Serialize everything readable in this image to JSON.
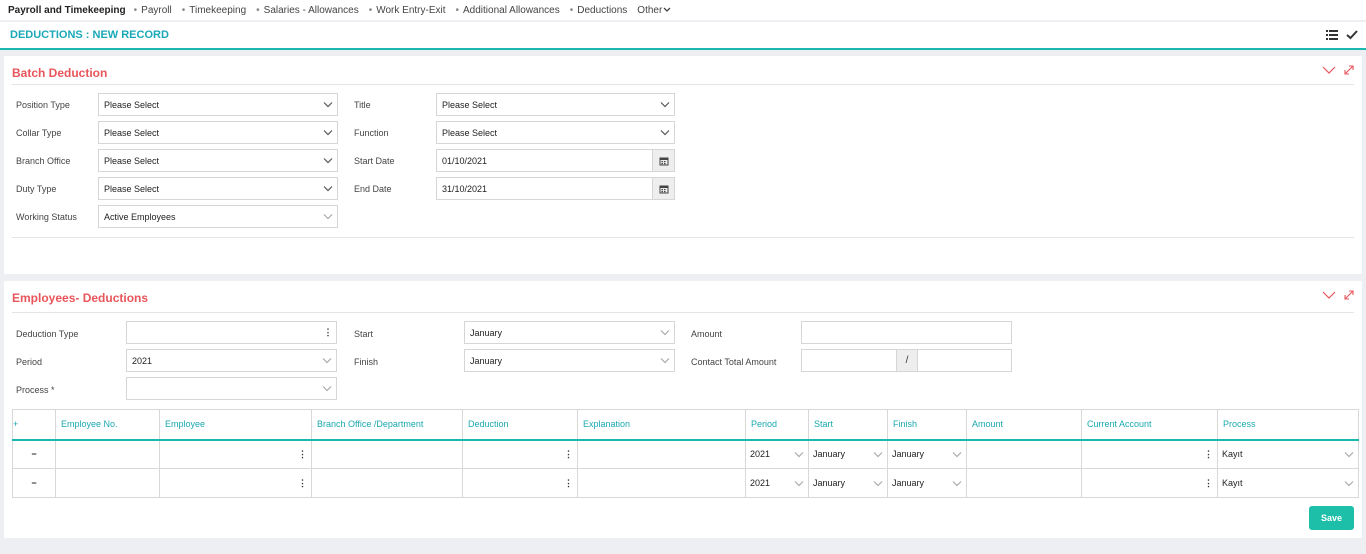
{
  "topnav": {
    "brand": "Payroll and Timekeeping",
    "items": [
      "Payroll",
      "Timekeeping",
      "Salaries - Allowances",
      "Work Entry-Exit",
      "Additional Allowances",
      "Deductions"
    ],
    "other": "Other"
  },
  "page": {
    "title": "DEDUCTIONS : NEW RECORD"
  },
  "batch": {
    "title": "Batch Deduction",
    "position_type": {
      "label": "Position Type",
      "value": "Please Select"
    },
    "collar_type": {
      "label": "Collar Type",
      "value": "Please Select"
    },
    "branch_office": {
      "label": "Branch Office",
      "value": "Please Select"
    },
    "duty_type": {
      "label": "Duty Type",
      "value": "Please Select"
    },
    "working_status": {
      "label": "Working Status",
      "value": "Active Employees"
    },
    "title_field": {
      "label": "Title",
      "value": "Please Select"
    },
    "function": {
      "label": "Function",
      "value": "Please Select"
    },
    "start_date": {
      "label": "Start Date",
      "value": "01/10/2021"
    },
    "end_date": {
      "label": "End Date",
      "value": "31/10/2021"
    }
  },
  "employees": {
    "title": "Employees- Deductions",
    "deduction_type": {
      "label": "Deduction Type",
      "value": ""
    },
    "period": {
      "label": "Period",
      "value": "2021"
    },
    "process": {
      "label": "Process *",
      "value": ""
    },
    "start": {
      "label": "Start",
      "value": "January"
    },
    "finish": {
      "label": "Finish",
      "value": "January"
    },
    "amount": {
      "label": "Amount",
      "value": ""
    },
    "contact_total": {
      "label": "Contact Total Amount",
      "separator": "/"
    },
    "table": {
      "add_symbol": "+",
      "remove_symbol": "−",
      "columns": [
        "Employee No.",
        "Employee",
        "Branch Office /Department",
        "Deduction",
        "Explanation",
        "Period",
        "Start",
        "Finish",
        "Amount",
        "Current Account",
        "Process"
      ],
      "rows": [
        {
          "period": "2021",
          "start": "January",
          "finish": "January",
          "process": "Kayıt"
        },
        {
          "period": "2021",
          "start": "January",
          "finish": "January",
          "process": "Kayıt"
        }
      ]
    },
    "save_label": "Save"
  },
  "colors": {
    "accent": "#1ab8b0",
    "section_title": "#e8555b",
    "save": "#1dbfa8"
  }
}
